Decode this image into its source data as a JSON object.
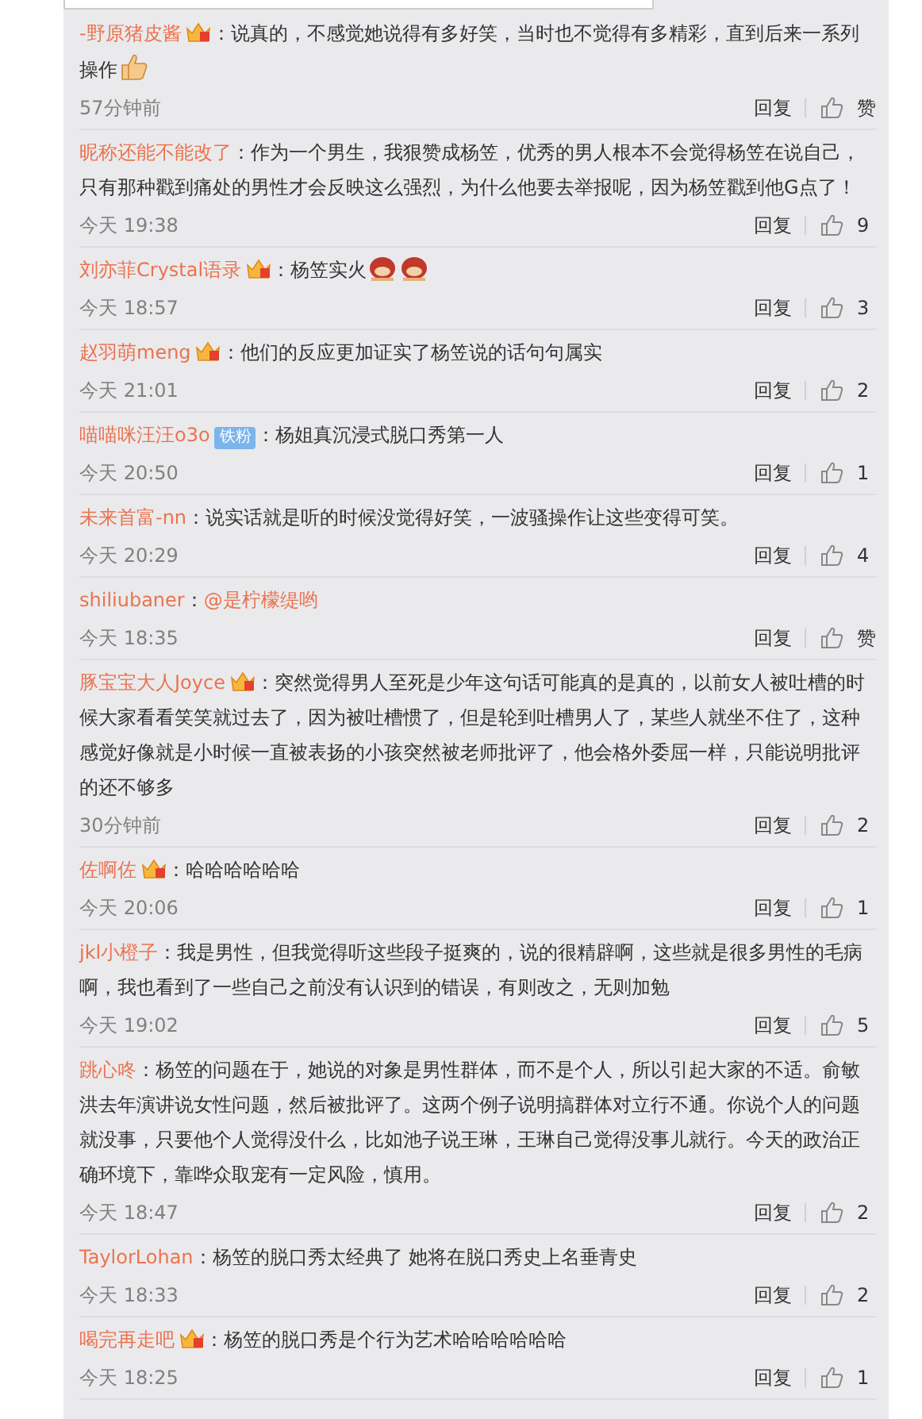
{
  "comments": [
    {
      "user": "-野原猪皮酱",
      "badge": {
        "kind": "crown"
      },
      "text": "：说真的，不感觉她说得有多好笑，当时也不觉得有多精彩，直到后来一系列操作",
      "emoji": [
        {
          "kind": "thumb"
        }
      ],
      "time": "57分钟前",
      "reply": "回复",
      "likes": "赞"
    },
    {
      "user": "昵称还能不能改了",
      "text": "：作为一个男生，我狠赞成杨笠，优秀的男人根本不会觉得杨笠在说自己，只有那种戳到痛处的男性才会反映这么强烈，为什么他要去举报呢，因为杨笠戳到他G点了！",
      "time": "今天 19:38",
      "reply": "回复",
      "likes": "9"
    },
    {
      "user": "刘亦菲Crystal语录",
      "badge": {
        "kind": "crown"
      },
      "text": "：杨笠实火",
      "emoji": [
        {
          "kind": "face"
        },
        {
          "kind": "face"
        }
      ],
      "time": "今天 18:57",
      "reply": "回复",
      "likes": "3"
    },
    {
      "user": "赵羽萌meng",
      "badge": {
        "kind": "crown"
      },
      "text": "：他们的反应更加证实了杨笠说的话句句属实",
      "time": "今天 21:01",
      "reply": "回复",
      "likes": "2"
    },
    {
      "user": "喵喵咪汪汪o3o",
      "badge": {
        "kind": "tag",
        "label": "铁粉"
      },
      "text": "：杨姐真沉浸式脱口秀第一人",
      "time": "今天 20:50",
      "reply": "回复",
      "likes": "1"
    },
    {
      "user": "未来首富-nn",
      "text": "：说实话就是听的时候没觉得好笑，一波骚操作让这些变得可笑。",
      "time": "今天 20:29",
      "reply": "回复",
      "likes": "4"
    },
    {
      "user": "shiliubaner",
      "text": "：",
      "mention": "@是柠檬缇哟",
      "time": "今天 18:35",
      "reply": "回复",
      "likes": "赞"
    },
    {
      "user": "豚宝宝大人Joyce",
      "badge": {
        "kind": "crown"
      },
      "text": "：突然觉得男人至死是少年这句话可能真的是真的，以前女人被吐槽的时候大家看看笑笑就过去了，因为被吐槽惯了，但是轮到吐槽男人了，某些人就坐不住了，这种感觉好像就是小时候一直被表扬的小孩突然被老师批评了，他会格外委屈一样，只能说明批评的还不够多",
      "time": "30分钟前",
      "reply": "回复",
      "likes": "2"
    },
    {
      "user": "佐啊佐",
      "badge": {
        "kind": "crown"
      },
      "text": "：哈哈哈哈哈哈",
      "time": "今天 20:06",
      "reply": "回复",
      "likes": "1"
    },
    {
      "user": "jkl小橙子",
      "text": "：我是男性，但我觉得听这些段子挺爽的，说的很精辟啊，这些就是很多男性的毛病啊，我也看到了一些自己之前没有认识到的错误，有则改之，无则加勉",
      "time": "今天 19:02",
      "reply": "回复",
      "likes": "5"
    },
    {
      "user": "跳心咚",
      "text": "：杨笠的问题在于，她说的对象是男性群体，而不是个人，所以引起大家的不适。俞敏洪去年演讲说女性问题，然后被批评了。这两个例子说明搞群体对立行不通。你说个人的问题就没事，只要他个人觉得没什么，比如池子说王琳，王琳自己觉得没事儿就行。今天的政治正确环境下，靠哗众取宠有一定风险，慎用。",
      "time": "今天 18:47",
      "reply": "回复",
      "likes": "2"
    },
    {
      "user": "TaylorLohan",
      "text": "：杨笠的脱口秀太经典了 她将在脱口秀史上名垂青史",
      "time": "今天 18:33",
      "reply": "回复",
      "likes": "2"
    },
    {
      "user": "喝完再走吧",
      "badge": {
        "kind": "crown"
      },
      "text": "：杨笠的脱口秀是个行为艺术哈哈哈哈哈哈",
      "time": "今天 18:25",
      "reply": "回复",
      "likes": "1"
    }
  ]
}
